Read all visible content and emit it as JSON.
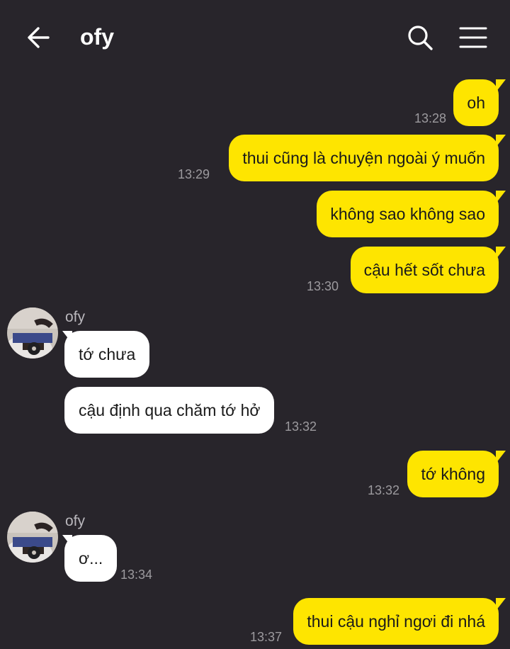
{
  "header": {
    "title": "ofy",
    "back_icon": "arrow-left-icon",
    "search_icon": "search-icon",
    "menu_icon": "hamburger-menu-icon"
  },
  "colors": {
    "background": "#28252b",
    "my_bubble": "#fee500",
    "their_bubble": "#ffffff",
    "timestamp": "#9c9a9e"
  },
  "messages": [
    {
      "from": "me",
      "text": "oh",
      "time": "13:28"
    },
    {
      "from": "me",
      "text": "thui cũng là chuyện ngoài ý muốn",
      "time": "13:29"
    },
    {
      "from": "me",
      "text": "không sao không sao",
      "time": ""
    },
    {
      "from": "me",
      "text": "cậu hết sốt chưa",
      "time": "13:30"
    },
    {
      "from": "them",
      "sender": "ofy",
      "text": "tớ chưa",
      "time": ""
    },
    {
      "from": "them",
      "text": "cậu định qua chăm tớ hở",
      "time": "13:32"
    },
    {
      "from": "me",
      "text": "tớ không",
      "time": "13:32"
    },
    {
      "from": "them",
      "sender": "ofy",
      "text": "ơ...",
      "time": "13:34"
    },
    {
      "from": "me",
      "text": "thui cậu nghỉ ngơi đi nhá",
      "time": "13:37"
    }
  ]
}
